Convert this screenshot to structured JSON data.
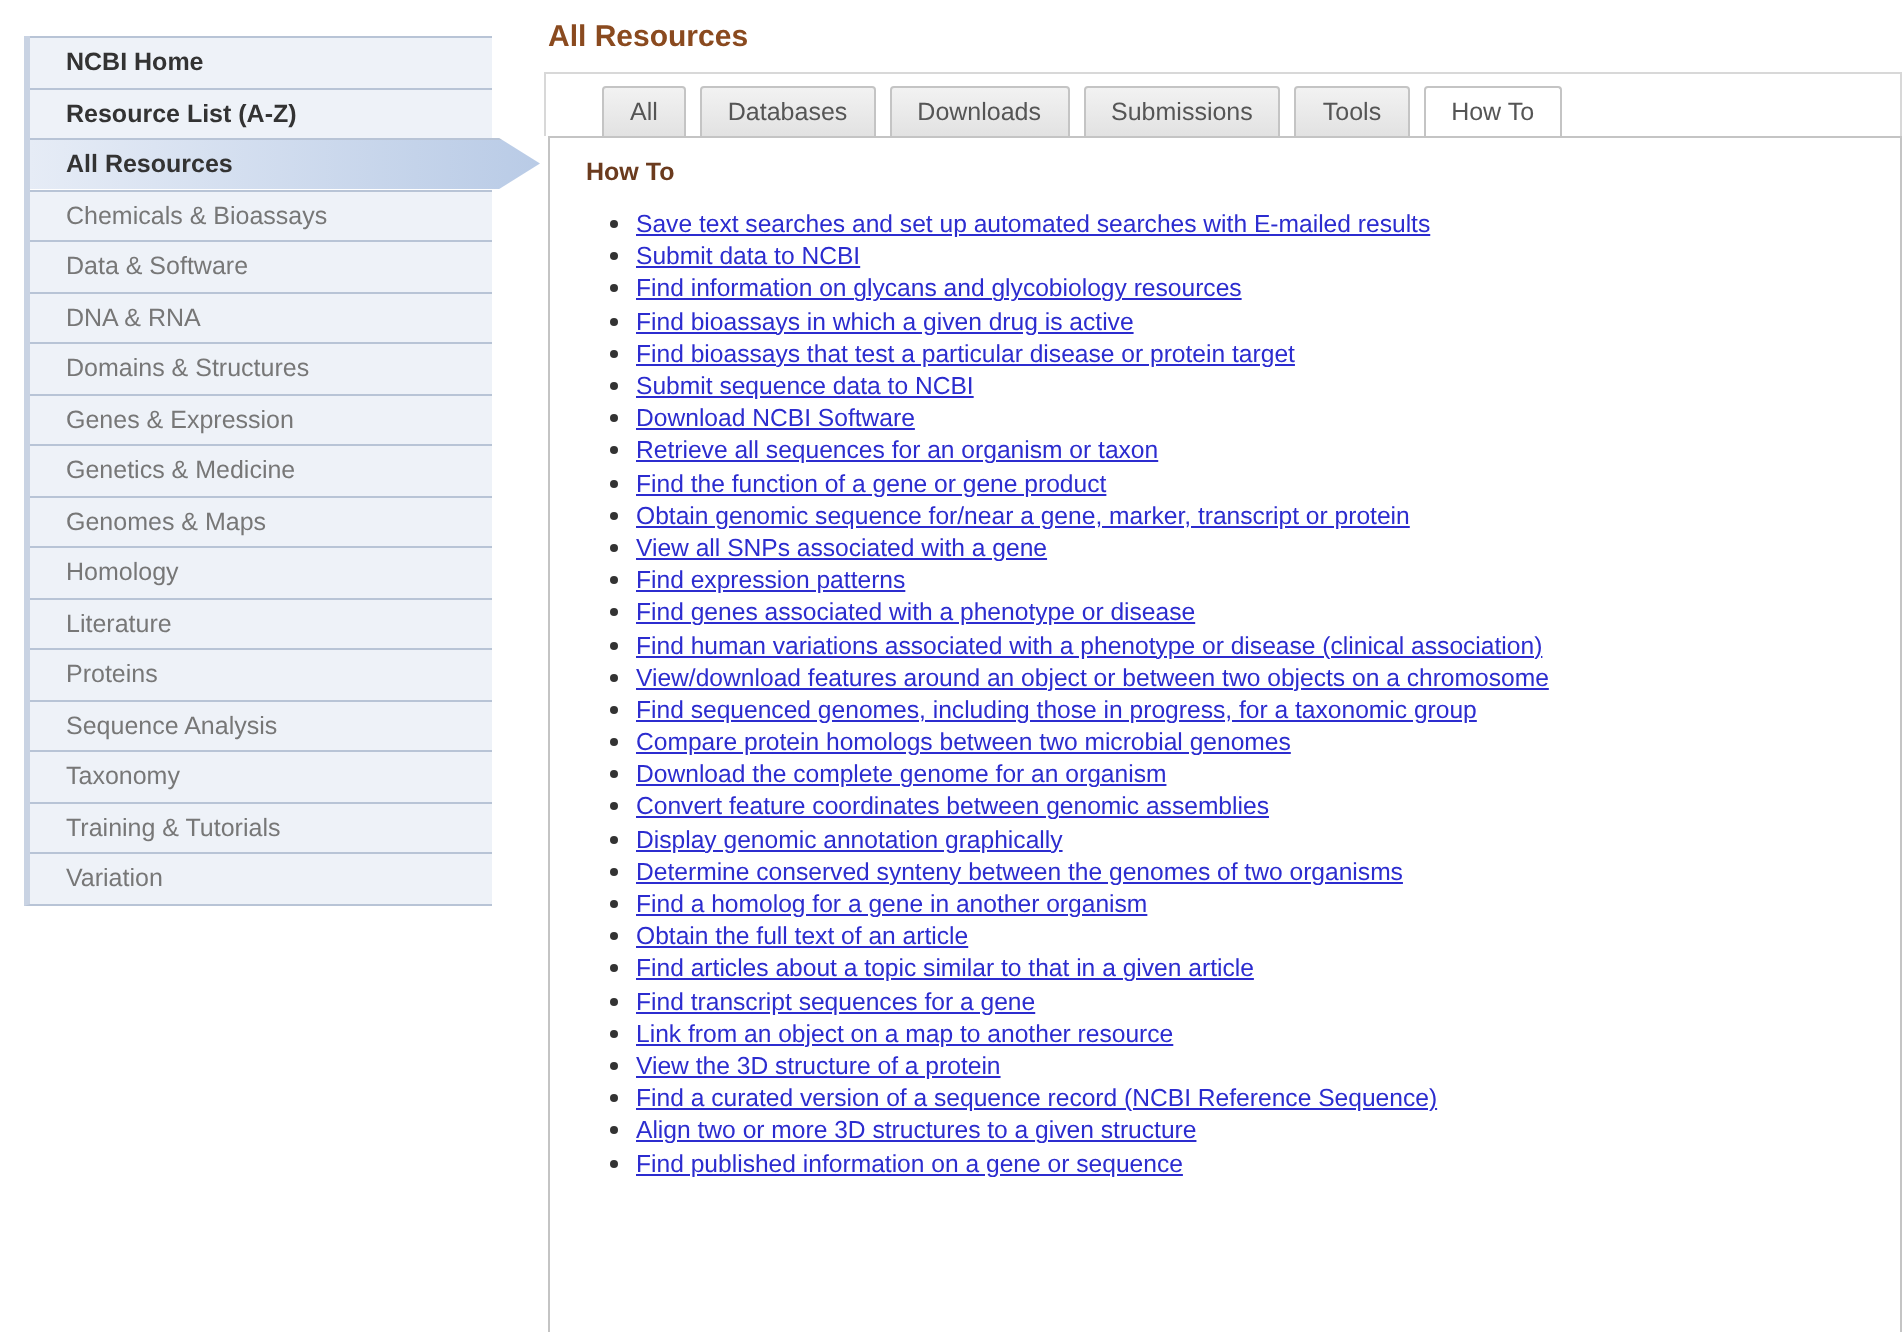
{
  "sidebar": {
    "items": [
      {
        "label": "NCBI Home",
        "kind": "heading",
        "selected": false
      },
      {
        "label": "Resource List (A-Z)",
        "kind": "heading",
        "selected": false
      },
      {
        "label": "All Resources",
        "kind": "heading",
        "selected": true
      },
      {
        "label": "Chemicals & Bioassays",
        "kind": "category",
        "selected": false
      },
      {
        "label": "Data & Software",
        "kind": "category",
        "selected": false
      },
      {
        "label": "DNA & RNA",
        "kind": "category",
        "selected": false
      },
      {
        "label": "Domains & Structures",
        "kind": "category",
        "selected": false
      },
      {
        "label": "Genes & Expression",
        "kind": "category",
        "selected": false
      },
      {
        "label": "Genetics & Medicine",
        "kind": "category",
        "selected": false
      },
      {
        "label": "Genomes & Maps",
        "kind": "category",
        "selected": false
      },
      {
        "label": "Homology",
        "kind": "category",
        "selected": false
      },
      {
        "label": "Literature",
        "kind": "category",
        "selected": false
      },
      {
        "label": "Proteins",
        "kind": "category",
        "selected": false
      },
      {
        "label": "Sequence Analysis",
        "kind": "category",
        "selected": false
      },
      {
        "label": "Taxonomy",
        "kind": "category",
        "selected": false
      },
      {
        "label": "Training & Tutorials",
        "kind": "category",
        "selected": false
      },
      {
        "label": "Variation",
        "kind": "category",
        "selected": false
      }
    ]
  },
  "page_title": "All Resources",
  "tabs": [
    {
      "label": "All",
      "selected": false
    },
    {
      "label": "Databases",
      "selected": false
    },
    {
      "label": "Downloads",
      "selected": false
    },
    {
      "label": "Submissions",
      "selected": false
    },
    {
      "label": "Tools",
      "selected": false
    },
    {
      "label": "How To",
      "selected": true
    }
  ],
  "section_title": "How To",
  "links": [
    "Save text searches and set up automated searches with E-mailed results",
    "Submit data to NCBI",
    "Find information on glycans and glycobiology resources",
    "Find bioassays in which a given drug is active",
    "Find bioassays that test a particular disease or protein target",
    "Submit sequence data to NCBI",
    "Download NCBI Software",
    "Retrieve all sequences for an organism or taxon",
    "Find the function of a gene or gene product",
    "Obtain genomic sequence for/near a gene, marker, transcript or protein",
    "View all SNPs associated with a gene",
    "Find expression patterns",
    "Find genes associated with a phenotype or disease",
    "Find human variations associated with a phenotype or disease (clinical association)",
    "View/download features around an object or between two objects on a chromosome",
    "Find sequenced genomes, including those in progress, for a taxonomic group",
    "Compare protein homologs between two microbial genomes",
    "Download the complete genome for an organism",
    "Convert feature coordinates between genomic assemblies",
    "Display genomic annotation graphically",
    "Determine conserved synteny between the genomes of two organisms",
    "Find a homolog for a gene in another organism",
    "Obtain the full text of an article",
    "Find articles about a topic similar to that in a given article",
    "Find transcript sequences for a gene",
    "Link from an object on a map to another resource",
    "View the 3D structure of a protein",
    "Find a curated version of a sequence record (NCBI Reference Sequence)",
    "Align two or more 3D structures to a given structure",
    "Find published information on a gene or sequence"
  ]
}
